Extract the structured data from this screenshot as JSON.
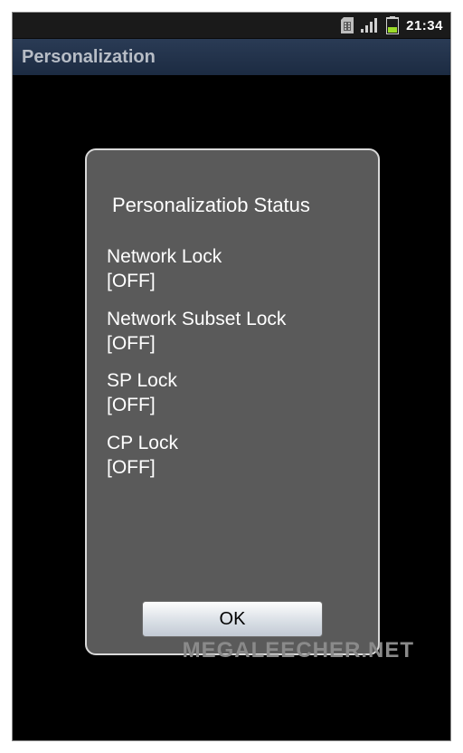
{
  "statusbar": {
    "time": "21:34",
    "battery_level": 40
  },
  "titlebar": {
    "title": "Personalization"
  },
  "dialog": {
    "title": "Personalizatiob Status",
    "locks": [
      {
        "name": "Network Lock",
        "value": "[OFF]"
      },
      {
        "name": "Network Subset Lock",
        "value": "[OFF]"
      },
      {
        "name": "SP Lock",
        "value": "[OFF]"
      },
      {
        "name": "CP Lock",
        "value": "[OFF]"
      }
    ],
    "ok_label": "OK"
  },
  "watermark": "MEGALEECHER.NET"
}
